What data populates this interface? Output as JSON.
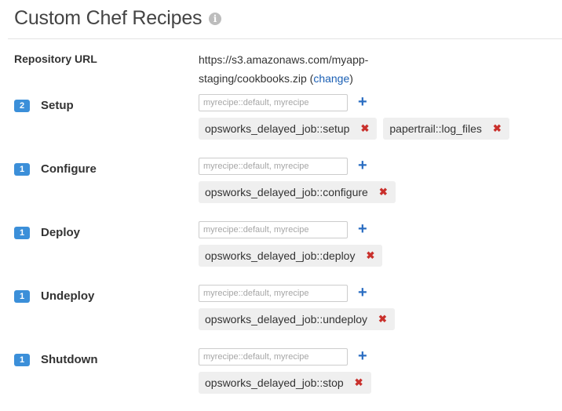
{
  "header": {
    "title": "Custom Chef Recipes",
    "info_glyph": "i"
  },
  "repository": {
    "label": "Repository URL",
    "url": "https://s3.amazonaws.com/myapp-staging/cookbooks.zip",
    "change_open": " (",
    "change_label": "change",
    "change_close": ")"
  },
  "input_placeholder": "myrecipe::default, myrecipe",
  "add_glyph": "+",
  "remove_glyph": "✖",
  "events": [
    {
      "name": "Setup",
      "count": "2",
      "recipes": [
        "opsworks_delayed_job::setup",
        "papertrail::log_files"
      ]
    },
    {
      "name": "Configure",
      "count": "1",
      "recipes": [
        "opsworks_delayed_job::configure"
      ]
    },
    {
      "name": "Deploy",
      "count": "1",
      "recipes": [
        "opsworks_delayed_job::deploy"
      ]
    },
    {
      "name": "Undeploy",
      "count": "1",
      "recipes": [
        "opsworks_delayed_job::undeploy"
      ]
    },
    {
      "name": "Shutdown",
      "count": "1",
      "recipes": [
        "opsworks_delayed_job::stop"
      ]
    }
  ],
  "colors": {
    "badge": "#3b8fd9",
    "link": "#1a5fb4",
    "add": "#2a6dc2",
    "remove": "#c9302c",
    "tag_bg": "#efefef"
  }
}
